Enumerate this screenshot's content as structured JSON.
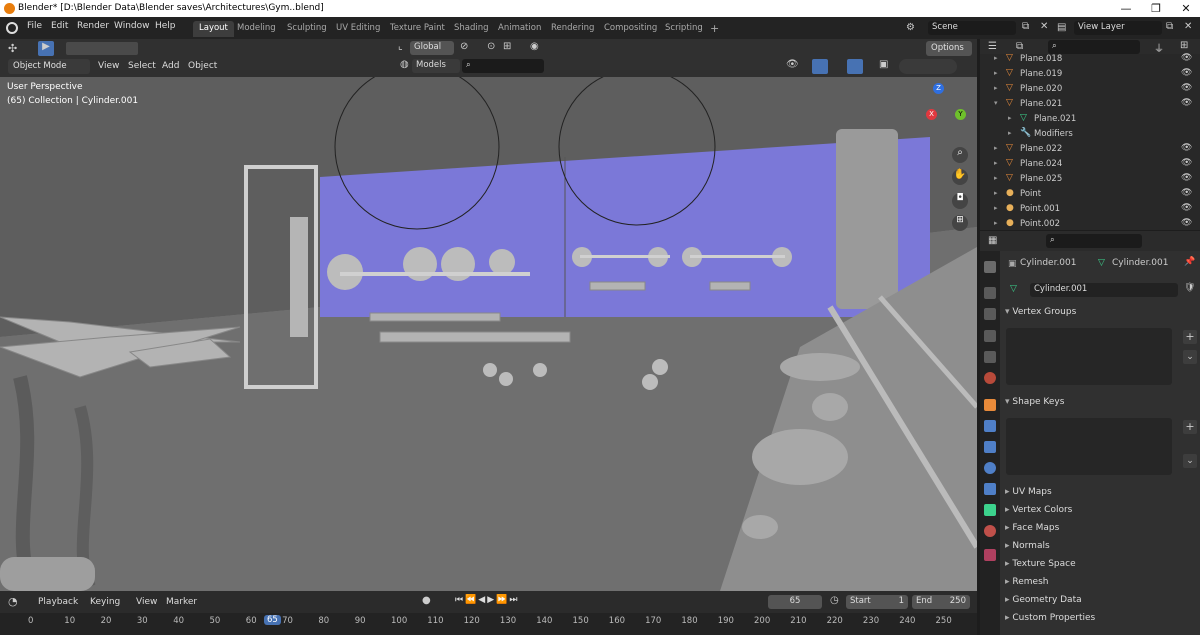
{
  "window": {
    "title": "Blender* [D:\\Blender Data\\Blender saves\\Architectures\\Gym..blend]",
    "minimize": "—",
    "restore": "❐",
    "close": "✕"
  },
  "menu": [
    "File",
    "Edit",
    "Render",
    "Window",
    "Help"
  ],
  "workspaces": [
    "Layout",
    "Modeling",
    "Sculpting",
    "UV Editing",
    "Texture Paint",
    "Shading",
    "Animation",
    "Rendering",
    "Compositing",
    "Scripting"
  ],
  "active_workspace": "Layout",
  "scene": {
    "label": "Scene",
    "view_layer": "View Layer"
  },
  "viewport_header": {
    "mode": "Object Mode",
    "menus": [
      "View",
      "Select",
      "Add",
      "Object"
    ],
    "orientation": "Global",
    "collection": "Models",
    "options": "Options"
  },
  "viewport": {
    "perspective": "User Perspective",
    "collection_info": "(65) Collection | Cylinder.001",
    "axis_labels": {
      "z": "Z",
      "y": "Y",
      "x": "X"
    }
  },
  "outliner": {
    "rows": [
      {
        "name": "Plane.018",
        "type": "mesh",
        "indent": 0
      },
      {
        "name": "Plane.019",
        "type": "mesh",
        "indent": 0
      },
      {
        "name": "Plane.020",
        "type": "mesh",
        "indent": 0
      },
      {
        "name": "Plane.021",
        "type": "mesh",
        "indent": 0,
        "expanded": true
      },
      {
        "name": "Plane.021",
        "type": "data",
        "indent": 1
      },
      {
        "name": "Modifiers",
        "type": "modifier",
        "indent": 1
      },
      {
        "name": "Plane.022",
        "type": "mesh",
        "indent": 0
      },
      {
        "name": "Plane.024",
        "type": "mesh",
        "indent": 0
      },
      {
        "name": "Plane.025",
        "type": "mesh",
        "indent": 0
      },
      {
        "name": "Point",
        "type": "light",
        "indent": 0
      },
      {
        "name": "Point.001",
        "type": "light",
        "indent": 0
      },
      {
        "name": "Point.002",
        "type": "light",
        "indent": 0
      }
    ]
  },
  "properties": {
    "object": "Cylinder.001",
    "mesh": "Cylinder.001",
    "data_name": "Cylinder.001",
    "panels_open": [
      "Vertex Groups",
      "Shape Keys"
    ],
    "panels_closed": [
      "UV Maps",
      "Vertex Colors",
      "Face Maps",
      "Normals",
      "Texture Space",
      "Remesh",
      "Geometry Data",
      "Custom Properties"
    ]
  },
  "timeline": {
    "menus": [
      "Playback",
      "Keying",
      "View",
      "Marker"
    ],
    "current_frame": "65",
    "start_label": "Start",
    "start": "1",
    "end_label": "End",
    "end": "250",
    "ticks": [
      "0",
      "10",
      "20",
      "30",
      "40",
      "50",
      "60",
      "65",
      "70",
      "80",
      "90",
      "100",
      "110",
      "120",
      "130",
      "140",
      "150",
      "160",
      "170",
      "180",
      "190",
      "200",
      "210",
      "220",
      "230",
      "240",
      "250"
    ]
  },
  "colors": {
    "accent": "#4772b3",
    "mesh_orange": "#e88a3a",
    "vertex_green": "#3cd28c",
    "wall_blue": "#7b78d8",
    "floor": "#7a7a7a"
  }
}
